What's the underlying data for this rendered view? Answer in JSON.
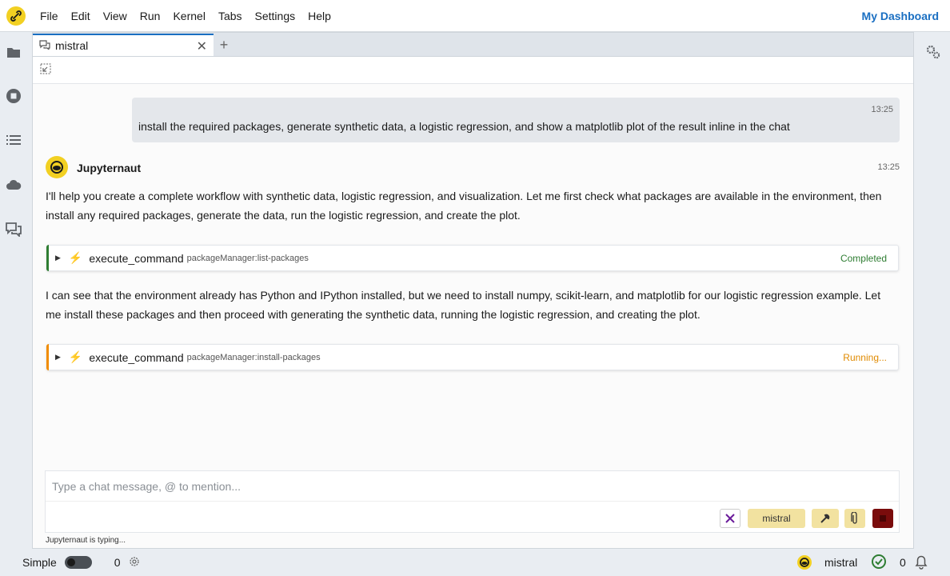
{
  "menubar": {
    "items": [
      "File",
      "Edit",
      "View",
      "Run",
      "Kernel",
      "Tabs",
      "Settings",
      "Help"
    ],
    "dashboard_label": "My Dashboard"
  },
  "tab": {
    "label": "mistral"
  },
  "chat": {
    "user_message": {
      "time": "13:25",
      "text": "install the required packages, generate synthetic data, a logistic regression, and show a matplotlib plot of the result inline in the chat"
    },
    "bot": {
      "name": "Jupyternaut",
      "time": "13:25",
      "para1": "I'll help you create a complete workflow with synthetic data, logistic regression, and visualization. Let me first check what packages are available in the environment, then install any required packages, generate the data, run the logistic regression, and create the plot.",
      "para2": "I can see that the environment already has Python and IPython installed, but we need to install numpy, scikit-learn, and matplotlib for our logistic regression example. Let me install these packages and then proceed with generating the synthetic data, running the logistic regression, and creating the plot."
    },
    "tool_calls": [
      {
        "name": "execute_command",
        "arg": "packageManager:list-packages",
        "status": "Completed",
        "status_color": "#2e7d32",
        "bar_color": "#2e7d32"
      },
      {
        "name": "execute_command",
        "arg": "packageManager:install-packages",
        "status": "Running...",
        "status_color": "#e08a00",
        "bar_color": "#f08c00"
      }
    ],
    "input_placeholder": "Type a chat message, @ to mention...",
    "model_button": "mistral",
    "typing_status": "Jupyternaut is typing..."
  },
  "statusbar": {
    "mode_label": "Simple",
    "terminal_count": "0",
    "kernel_name": "mistral",
    "notification_count": "0"
  },
  "colors": {
    "accent": "#1a6fc2",
    "logo_yellow": "#f2d022",
    "model_button_bg": "#f2e2a0",
    "stop_button_bg": "#7a0c0c",
    "clear_button_color": "#6a1b9a"
  }
}
